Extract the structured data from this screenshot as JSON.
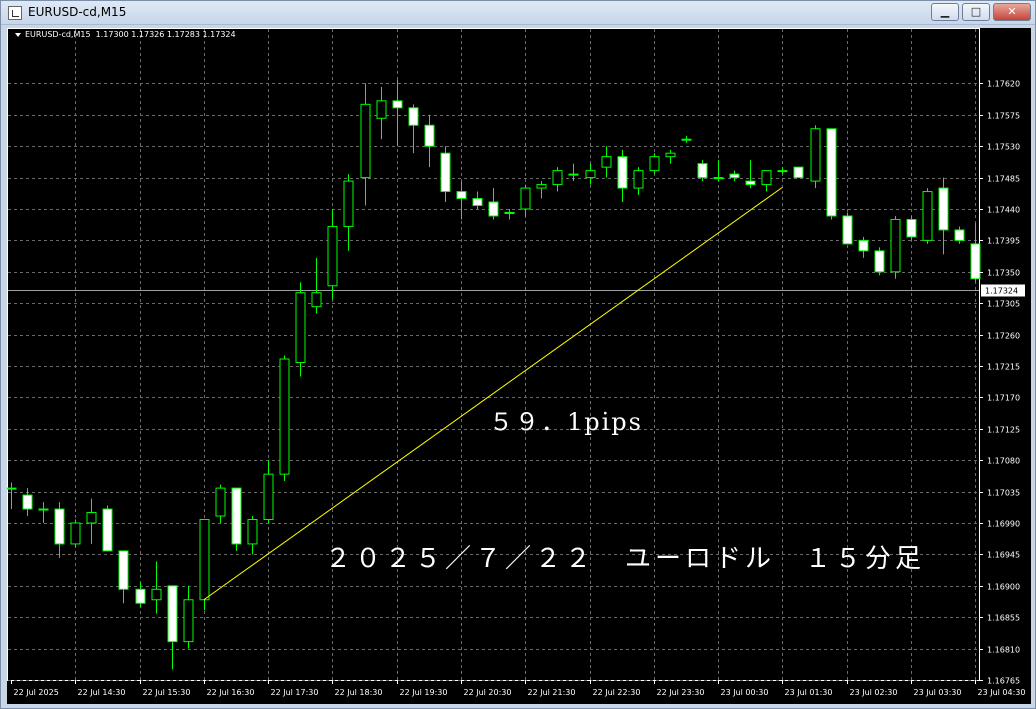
{
  "window": {
    "title": "EURUSD-cd,M15",
    "btn_min": "▁",
    "btn_max": "□",
    "btn_close": "✕"
  },
  "chart_header": {
    "symbol": "EURUSD-cd,M15",
    "ohlc": "1.17300 1.17326 1.17283 1.17324"
  },
  "annotations": {
    "pips": "５９．1pips",
    "title": "２０２５／７／２２　ユーロドル　１５分足"
  },
  "colors": {
    "background": "#000000",
    "grid": "#6b6b6b",
    "candle_wick": "#00ff00",
    "bull_body": "#000000",
    "bear_body": "#ffffff",
    "trendline": "#ffff00",
    "axis_text": "#ffffff"
  },
  "chart_data": {
    "type": "candlestick",
    "symbol": "EURUSD-cd",
    "timeframe": "M15",
    "ylim": [
      1.16765,
      1.17665
    ],
    "y_ticks": [
      "1.17620",
      "1.17575",
      "1.17530",
      "1.17485",
      "1.17440",
      "1.17395",
      "1.17350",
      "1.17305",
      "1.17260",
      "1.17215",
      "1.17170",
      "1.17125",
      "1.17080",
      "1.17035",
      "1.16990",
      "1.16945",
      "1.16900",
      "1.16855",
      "1.16810",
      "1.16765"
    ],
    "current_price": "1.17324",
    "x_labels": [
      "22 Jul 2025",
      "22 Jul 14:30",
      "22 Jul 15:30",
      "22 Jul 16:30",
      "22 Jul 17:30",
      "22 Jul 18:30",
      "22 Jul 19:30",
      "22 Jul 20:30",
      "22 Jul 21:30",
      "22 Jul 22:30",
      "22 Jul 23:30",
      "23 Jul 00:30",
      "23 Jul 01:30",
      "23 Jul 02:30",
      "23 Jul 03:30",
      "23 Jul 04:30"
    ],
    "candles": [
      {
        "o": 1.1704,
        "h": 1.17048,
        "l": 1.1701,
        "c": 1.1704
      },
      {
        "o": 1.1703,
        "h": 1.1704,
        "l": 1.17,
        "c": 1.1701
      },
      {
        "o": 1.1701,
        "h": 1.1702,
        "l": 1.1699,
        "c": 1.1701
      },
      {
        "o": 1.1701,
        "h": 1.1702,
        "l": 1.1694,
        "c": 1.1696
      },
      {
        "o": 1.1696,
        "h": 1.16995,
        "l": 1.16955,
        "c": 1.1699
      },
      {
        "o": 1.1699,
        "h": 1.17025,
        "l": 1.1696,
        "c": 1.17005
      },
      {
        "o": 1.1701,
        "h": 1.17015,
        "l": 1.1695,
        "c": 1.1695
      },
      {
        "o": 1.1695,
        "h": 1.1695,
        "l": 1.16875,
        "c": 1.16895
      },
      {
        "o": 1.16895,
        "h": 1.16905,
        "l": 1.1687,
        "c": 1.16875
      },
      {
        "o": 1.1688,
        "h": 1.16935,
        "l": 1.1686,
        "c": 1.16895
      },
      {
        "o": 1.169,
        "h": 1.169,
        "l": 1.1678,
        "c": 1.1682
      },
      {
        "o": 1.1682,
        "h": 1.169,
        "l": 1.1681,
        "c": 1.1688
      },
      {
        "o": 1.1688,
        "h": 1.16995,
        "l": 1.16865,
        "c": 1.16995
      },
      {
        "o": 1.17,
        "h": 1.17045,
        "l": 1.1699,
        "c": 1.1704
      },
      {
        "o": 1.1704,
        "h": 1.1704,
        "l": 1.1695,
        "c": 1.1696
      },
      {
        "o": 1.1696,
        "h": 1.17,
        "l": 1.16945,
        "c": 1.16995
      },
      {
        "o": 1.16995,
        "h": 1.1708,
        "l": 1.1699,
        "c": 1.1706
      },
      {
        "o": 1.1706,
        "h": 1.1723,
        "l": 1.1705,
        "c": 1.17225
      },
      {
        "o": 1.1722,
        "h": 1.17335,
        "l": 1.172,
        "c": 1.1732
      },
      {
        "o": 1.173,
        "h": 1.1737,
        "l": 1.1729,
        "c": 1.1732
      },
      {
        "o": 1.1733,
        "h": 1.1744,
        "l": 1.1731,
        "c": 1.17415
      },
      {
        "o": 1.17415,
        "h": 1.1749,
        "l": 1.1738,
        "c": 1.1748
      },
      {
        "o": 1.17485,
        "h": 1.1762,
        "l": 1.17445,
        "c": 1.1759
      },
      {
        "o": 1.1757,
        "h": 1.17615,
        "l": 1.1754,
        "c": 1.17595
      },
      {
        "o": 1.17595,
        "h": 1.17625,
        "l": 1.1753,
        "c": 1.17585
      },
      {
        "o": 1.17585,
        "h": 1.1759,
        "l": 1.1752,
        "c": 1.1756
      },
      {
        "o": 1.1756,
        "h": 1.17575,
        "l": 1.175,
        "c": 1.1753
      },
      {
        "o": 1.1752,
        "h": 1.1753,
        "l": 1.1745,
        "c": 1.17465
      },
      {
        "o": 1.17465,
        "h": 1.1748,
        "l": 1.17425,
        "c": 1.17455
      },
      {
        "o": 1.17455,
        "h": 1.17465,
        "l": 1.1744,
        "c": 1.17445
      },
      {
        "o": 1.1745,
        "h": 1.1747,
        "l": 1.17425,
        "c": 1.1743
      },
      {
        "o": 1.17435,
        "h": 1.1744,
        "l": 1.17425,
        "c": 1.17435
      },
      {
        "o": 1.1744,
        "h": 1.17475,
        "l": 1.1743,
        "c": 1.1747
      },
      {
        "o": 1.1747,
        "h": 1.1748,
        "l": 1.17455,
        "c": 1.17475
      },
      {
        "o": 1.17475,
        "h": 1.175,
        "l": 1.17465,
        "c": 1.17495
      },
      {
        "o": 1.1749,
        "h": 1.17505,
        "l": 1.1748,
        "c": 1.1749
      },
      {
        "o": 1.17485,
        "h": 1.17505,
        "l": 1.17475,
        "c": 1.17495
      },
      {
        "o": 1.175,
        "h": 1.1753,
        "l": 1.17485,
        "c": 1.17515
      },
      {
        "o": 1.17515,
        "h": 1.17525,
        "l": 1.1745,
        "c": 1.1747
      },
      {
        "o": 1.1747,
        "h": 1.175,
        "l": 1.1746,
        "c": 1.17495
      },
      {
        "o": 1.17495,
        "h": 1.1752,
        "l": 1.1749,
        "c": 1.17515
      },
      {
        "o": 1.17515,
        "h": 1.17525,
        "l": 1.17505,
        "c": 1.1752
      },
      {
        "o": 1.1754,
        "h": 1.17545,
        "l": 1.17535,
        "c": 1.1754
      },
      {
        "o": 1.17505,
        "h": 1.1751,
        "l": 1.1748,
        "c": 1.17485
      },
      {
        "o": 1.17485,
        "h": 1.1751,
        "l": 1.1748,
        "c": 1.17485
      },
      {
        "o": 1.1749,
        "h": 1.17495,
        "l": 1.1748,
        "c": 1.17485
      },
      {
        "o": 1.1748,
        "h": 1.1751,
        "l": 1.1747,
        "c": 1.17475
      },
      {
        "o": 1.17475,
        "h": 1.17495,
        "l": 1.17465,
        "c": 1.17495
      },
      {
        "o": 1.17495,
        "h": 1.175,
        "l": 1.1749,
        "c": 1.17495
      },
      {
        "o": 1.175,
        "h": 1.175,
        "l": 1.17485,
        "c": 1.17485
      },
      {
        "o": 1.1748,
        "h": 1.1756,
        "l": 1.1747,
        "c": 1.17555
      },
      {
        "o": 1.17555,
        "h": 1.17555,
        "l": 1.17425,
        "c": 1.1743
      },
      {
        "o": 1.1743,
        "h": 1.17435,
        "l": 1.1739,
        "c": 1.1739
      },
      {
        "o": 1.17395,
        "h": 1.174,
        "l": 1.1737,
        "c": 1.1738
      },
      {
        "o": 1.1738,
        "h": 1.17385,
        "l": 1.17345,
        "c": 1.1735
      },
      {
        "o": 1.1735,
        "h": 1.1743,
        "l": 1.1734,
        "c": 1.17425
      },
      {
        "o": 1.17425,
        "h": 1.1743,
        "l": 1.17395,
        "c": 1.174
      },
      {
        "o": 1.17395,
        "h": 1.1747,
        "l": 1.1739,
        "c": 1.17465
      },
      {
        "o": 1.1747,
        "h": 1.17485,
        "l": 1.17375,
        "c": 1.1741
      },
      {
        "o": 1.1741,
        "h": 1.17415,
        "l": 1.1739,
        "c": 1.17395
      },
      {
        "o": 1.1739,
        "h": 1.1742,
        "l": 1.17335,
        "c": 1.1734
      }
    ],
    "trendline": {
      "from_index": 12,
      "from_price": 1.1688,
      "to_index": 48,
      "to_price": 1.17471
    }
  }
}
